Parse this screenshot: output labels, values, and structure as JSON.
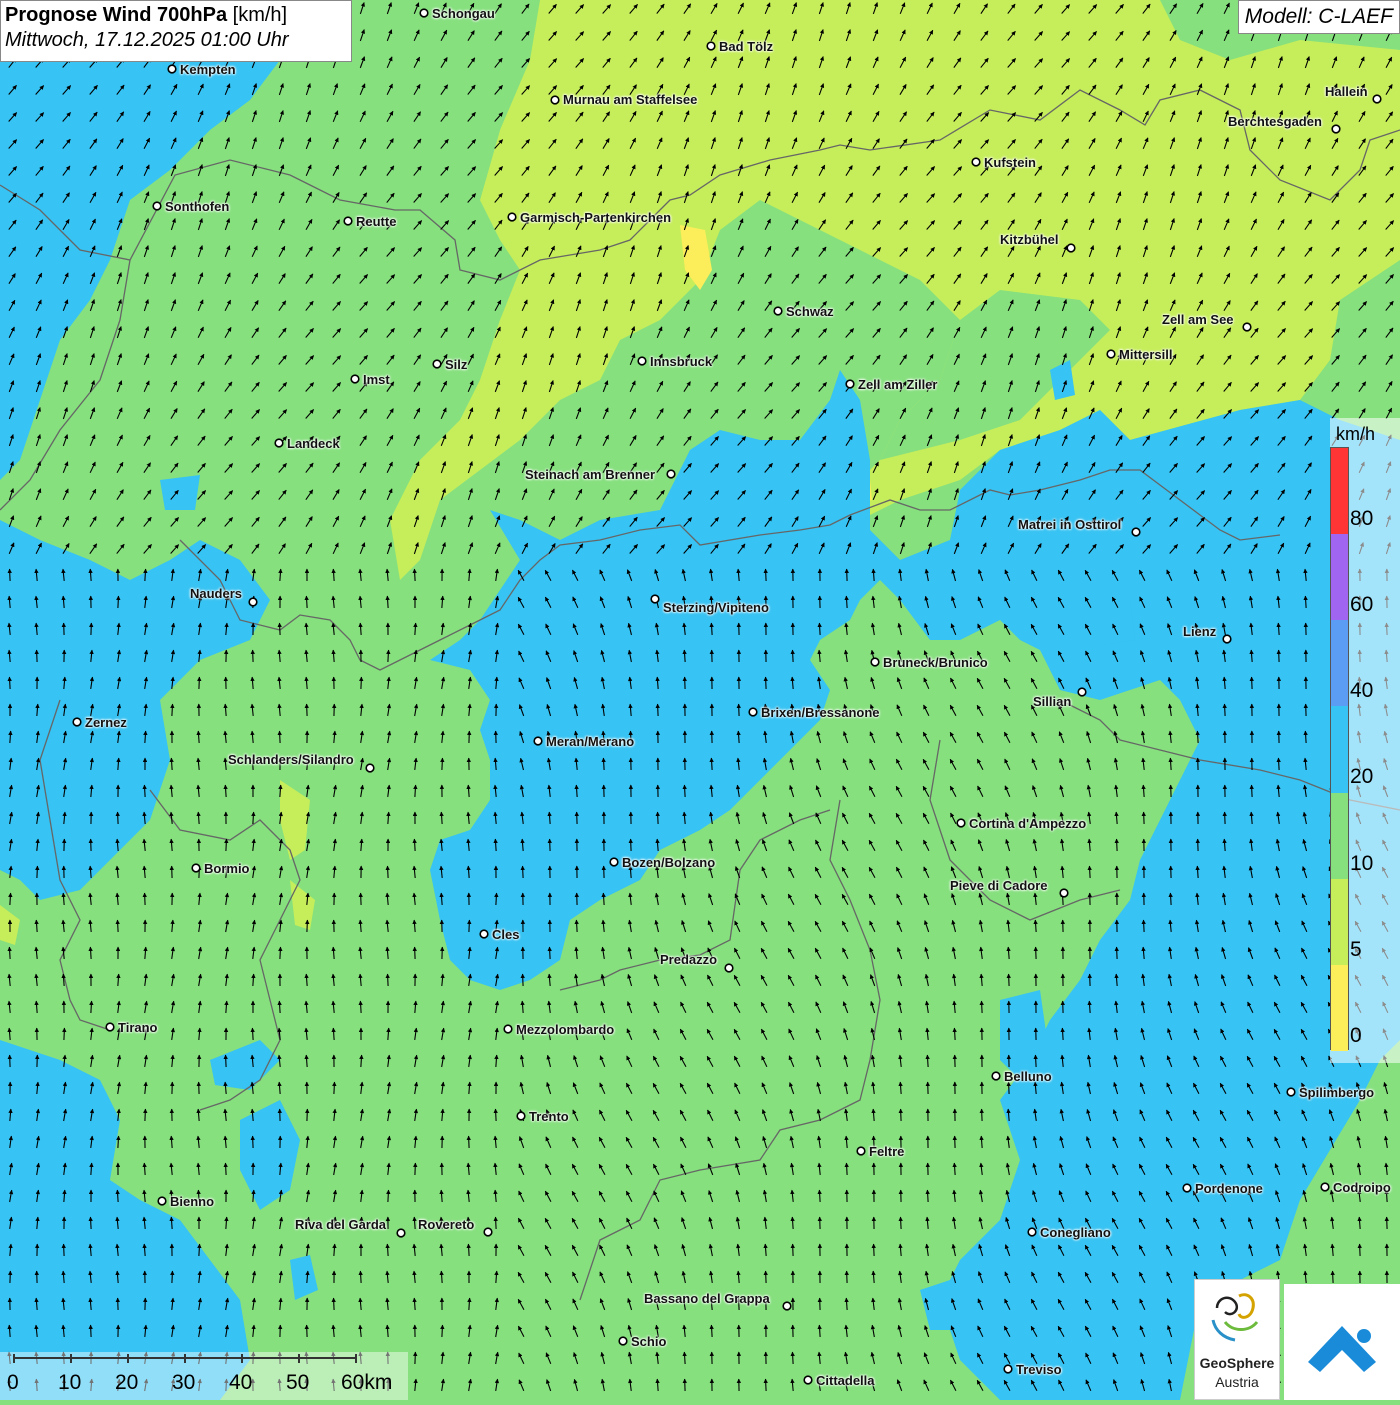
{
  "header": {
    "title_bold": "Prognose Wind 700hPa",
    "title_unit": "[km/h]",
    "datetime": "Mittwoch, 17.12.2025 01:00 Uhr",
    "model": "Modell: C-LAEF"
  },
  "legend": {
    "unit": "km/h",
    "labels": [
      "80",
      "60",
      "40",
      "20",
      "10",
      "5",
      "0"
    ],
    "colors": [
      "#ff3535",
      "#a066f2",
      "#5b9cf5",
      "#37c3f3",
      "#86e07e",
      "#c6ee5a",
      "#fcee5a"
    ]
  },
  "scale": {
    "labels": [
      "0",
      "10",
      "20",
      "30",
      "40",
      "50",
      "60km"
    ]
  },
  "cities": [
    {
      "name": "Schongau"
    },
    {
      "name": "Bad Tölz"
    },
    {
      "name": "Kempten"
    },
    {
      "name": "Murnau am Staffelsee"
    },
    {
      "name": "Hallein"
    },
    {
      "name": "Berchtesgaden"
    },
    {
      "name": "Kufstein"
    },
    {
      "name": "Sonthofen"
    },
    {
      "name": "Reutte"
    },
    {
      "name": "Garmisch-Partenkirchen"
    },
    {
      "name": "Kitzbühel"
    },
    {
      "name": "Schwaz"
    },
    {
      "name": "Zell am See"
    },
    {
      "name": "Mittersill"
    },
    {
      "name": "Innsbruck"
    },
    {
      "name": "Silz"
    },
    {
      "name": "Imst"
    },
    {
      "name": "Zell am Ziller"
    },
    {
      "name": "Landeck"
    },
    {
      "name": "Steinach am Brenner"
    },
    {
      "name": "Matrei in Osttirol"
    },
    {
      "name": "Nauders"
    },
    {
      "name": "Sterzing/Vipiteno"
    },
    {
      "name": "Lienz"
    },
    {
      "name": "Bruneck/Brunico"
    },
    {
      "name": "Sillian"
    },
    {
      "name": "Zernez"
    },
    {
      "name": "Brixen/Bressanone"
    },
    {
      "name": "Meran/Merano"
    },
    {
      "name": "Schlanders/Silandro"
    },
    {
      "name": "Cortina d'Ampezzo"
    },
    {
      "name": "Bozen/Bolzano"
    },
    {
      "name": "Bormio"
    },
    {
      "name": "Pieve di Cadore"
    },
    {
      "name": "Cles"
    },
    {
      "name": "Predazzo"
    },
    {
      "name": "Tirano"
    },
    {
      "name": "Mezzolombardo"
    },
    {
      "name": "Belluno"
    },
    {
      "name": "Spilimbergo"
    },
    {
      "name": "Trento"
    },
    {
      "name": "Feltre"
    },
    {
      "name": "Pordenone"
    },
    {
      "name": "Codroipo"
    },
    {
      "name": "Bienno"
    },
    {
      "name": "Riva del Garda"
    },
    {
      "name": "Rovereto"
    },
    {
      "name": "Conegliano"
    },
    {
      "name": "Bassano del Grappa"
    },
    {
      "name": "Schio"
    },
    {
      "name": "Treviso"
    },
    {
      "name": "Cittadella"
    }
  ],
  "logo": {
    "name": "GeoSphere",
    "country": "Austria"
  }
}
